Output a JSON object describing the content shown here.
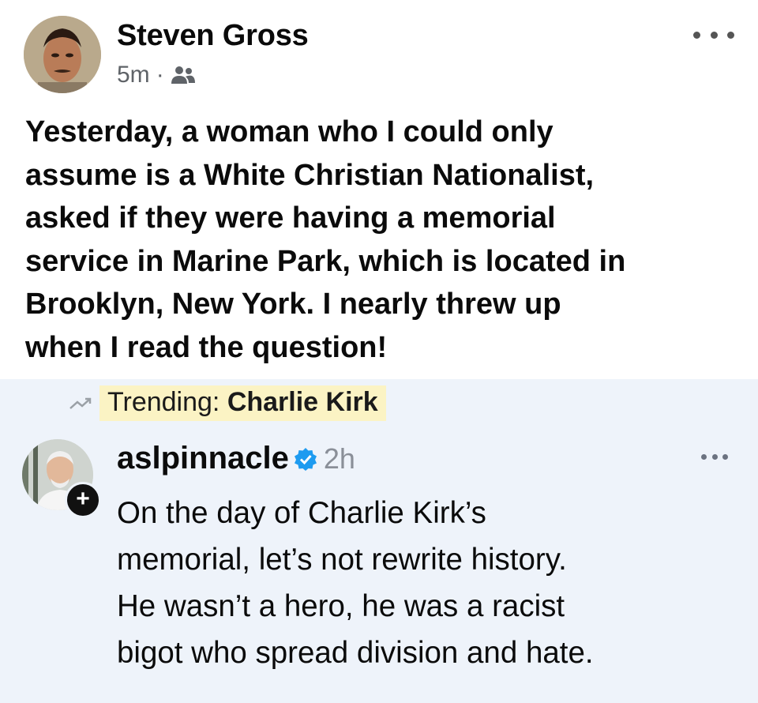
{
  "post": {
    "author": "Steven Gross",
    "time": "5m",
    "separator": "·",
    "audience_icon": "friends-icon",
    "more_icon": "more-options-icon",
    "text_lines": [
      "Yesterday, a woman who I could only",
      "assume is a White Christian Nationalist,",
      "asked if they were having a memorial",
      "service in Marine Park, which is located in",
      "Brooklyn, New York. I nearly threw up",
      "when I read the question!"
    ]
  },
  "quote": {
    "trend_prefix": "Trending: ",
    "trend_topic": "Charlie Kirk",
    "trend_icon": "trending-icon",
    "username": "aslpinnacle",
    "verified_icon": "verified-badge-icon",
    "time": "2h",
    "follow_badge": "+",
    "text_lines": [
      "On the day of Charlie Kirk’s",
      "memorial, let’s not rewrite history.",
      "He wasn’t a hero, he was a racist",
      "bigot who spread division and hate."
    ]
  },
  "colors": {
    "quote_background": "#eef3fa",
    "trend_highlight": "#fbf3c4",
    "verified_blue": "#1d9bf0",
    "meta_gray": "#5f6368"
  }
}
